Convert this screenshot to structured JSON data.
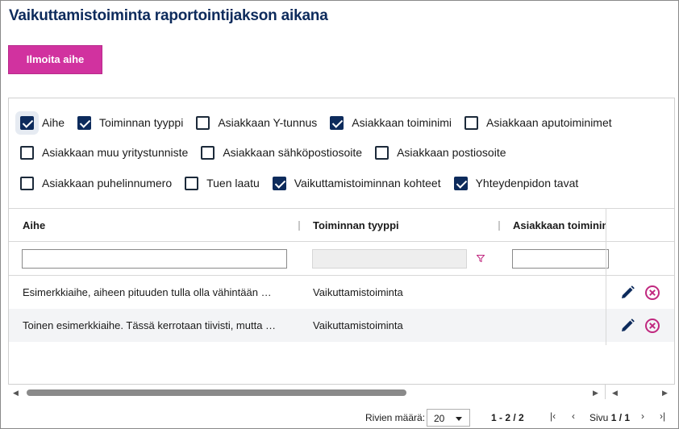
{
  "title": "Vaikuttamistoiminta raportointijakson aikana",
  "report_button": "Ilmoita aihe",
  "columns_toggle": [
    {
      "label": "Aihe",
      "checked": true
    },
    {
      "label": "Toiminnan tyyppi",
      "checked": true
    },
    {
      "label": "Asiakkaan Y-tunnus",
      "checked": false
    },
    {
      "label": "Asiakkaan toiminimi",
      "checked": true
    },
    {
      "label": "Asiakkaan aputoiminimet",
      "checked": false
    },
    {
      "label": "Asiakkaan muu yritystunniste",
      "checked": false
    },
    {
      "label": "Asiakkaan sähköpostiosoite",
      "checked": false
    },
    {
      "label": "Asiakkaan postiosoite",
      "checked": false
    },
    {
      "label": "Asiakkaan puhelinnumero",
      "checked": false
    },
    {
      "label": "Tuen laatu",
      "checked": false
    },
    {
      "label": "Vaikuttamistoiminnan kohteet",
      "checked": true
    },
    {
      "label": "Yhteydenpidon tavat",
      "checked": true
    }
  ],
  "grid": {
    "headers": [
      "Aihe",
      "Toiminnan tyyppi",
      "Asiakkaan toiminimi"
    ],
    "filters": {
      "aihe": "",
      "toiminnan_tyyppi": "",
      "toiminimi": ""
    },
    "rows": [
      {
        "aihe": "Esimerkkiaihe, aiheen pituuden tulla olla vähintään …",
        "tyyppi": "Vaikuttamistoiminta"
      },
      {
        "aihe": "Toinen esimerkkiaihe. Tässä kerrotaan tiivisti, mutta …",
        "tyyppi": "Vaikuttamistoiminta"
      }
    ]
  },
  "pagination": {
    "rows_label": "Rivien määrä:",
    "page_size": "20",
    "range": "1 - 2 / 2",
    "page_label": "Sivu",
    "page": "1 / 1"
  },
  "colors": {
    "accent": "#d1329f",
    "navy": "#0d2b5c",
    "delete": "#c0287f"
  },
  "icons": [
    "pencil-icon",
    "delete-circle-icon",
    "filter-funnel-icon",
    "first-page-icon",
    "prev-page-icon",
    "next-page-icon",
    "last-page-icon"
  ]
}
